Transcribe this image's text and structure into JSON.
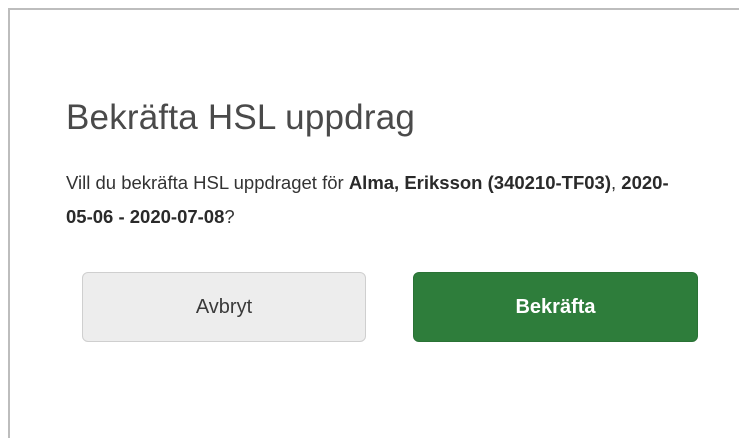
{
  "dialog": {
    "title": "Bekräfta HSL uppdrag",
    "message": {
      "prefix": "Vill du bekräfta HSL uppdraget för ",
      "patient": "Alma, Eriksson (340210-TF03)",
      "separator": ", ",
      "period": "2020-05-06 - 2020-07-08",
      "suffix": "?"
    },
    "cancel_label": "Avbryt",
    "confirm_label": "Bekräfta"
  },
  "colors": {
    "confirm_button": "#2e7d3b",
    "cancel_button": "#ededed"
  }
}
